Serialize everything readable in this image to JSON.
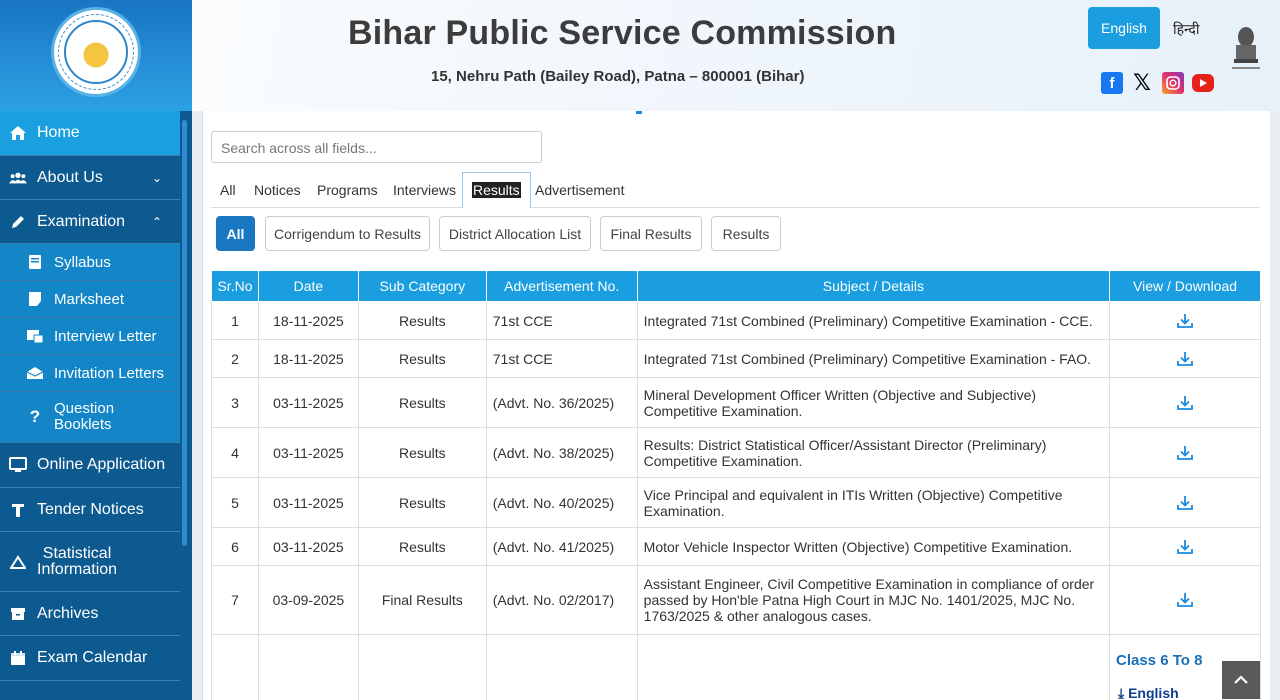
{
  "header": {
    "title": "Bihar Public Service Commission",
    "address": "15, Nehru Path (Bailey Road), Patna – 800001 (Bihar)",
    "lang_english": "English",
    "lang_hindi": "हिन्दी"
  },
  "sidebar": {
    "items": [
      {
        "label": "Home",
        "icon": "home-icon",
        "active": true
      },
      {
        "label": "About Us",
        "icon": "users-icon"
      },
      {
        "label": "Examination",
        "icon": "pencil-icon"
      },
      {
        "label": "Syllabus",
        "icon": "book-icon",
        "sub": true
      },
      {
        "label": "Marksheet",
        "icon": "sheet-icon",
        "sub": true
      },
      {
        "label": "Interview Letter",
        "icon": "letter-icon",
        "sub": true
      },
      {
        "label": "Invitation Letters",
        "icon": "envelope-icon",
        "sub": true
      },
      {
        "label": "Question",
        "label2": "Booklets",
        "icon": "question-icon",
        "sub": true
      },
      {
        "label": "Online Application",
        "icon": "monitor-icon"
      },
      {
        "label": "Tender Notices",
        "icon": "tender-icon"
      },
      {
        "label": "Statistical",
        "label2": "Information",
        "icon": "chart-icon"
      },
      {
        "label": "Archives",
        "icon": "archive-icon"
      },
      {
        "label": "Exam Calendar",
        "icon": "calendar-icon"
      }
    ]
  },
  "search": {
    "placeholder": "Search across all fields..."
  },
  "tabs": [
    "All",
    "Notices",
    "Programs",
    "Interviews",
    "Results",
    "Advertisement"
  ],
  "filters": [
    "All",
    "Corrigendum to Results",
    "District Allocation List",
    "Final Results",
    "Results"
  ],
  "table": {
    "headers": [
      "Sr.No",
      "Date",
      "Sub Category",
      "Advertisement No.",
      "Subject / Details",
      "View / Download"
    ],
    "rows": [
      {
        "sr": "1",
        "date": "18-11-2025",
        "cat": "Results",
        "adv": "71st CCE",
        "subject": "Integrated 71st Combined (Preliminary) Competitive Examination - CCE."
      },
      {
        "sr": "2",
        "date": "18-11-2025",
        "cat": "Results",
        "adv": "71st CCE",
        "subject": "Integrated 71st Combined (Preliminary) Competitive Examination - FAO."
      },
      {
        "sr": "3",
        "date": "03-11-2025",
        "cat": "Results",
        "adv": "(Advt. No. 36/2025)",
        "subject": "Mineral Development Officer Written (Objective and Subjective) Competitive Examination."
      },
      {
        "sr": "4",
        "date": "03-11-2025",
        "cat": "Results",
        "adv": "(Advt. No. 38/2025)",
        "subject": "Results: District Statistical Officer/Assistant Director (Preliminary) Competitive Examination."
      },
      {
        "sr": "5",
        "date": "03-11-2025",
        "cat": "Results",
        "adv": "(Advt. No. 40/2025)",
        "subject": "Vice Principal and equivalent in ITIs Written (Objective) Competitive Examination."
      },
      {
        "sr": "6",
        "date": "03-11-2025",
        "cat": "Results",
        "adv": "(Advt. No. 41/2025)",
        "subject": "Motor Vehicle Inspector Written (Objective) Competitive Examination."
      },
      {
        "sr": "7",
        "date": "03-09-2025",
        "cat": "Final Results",
        "adv": "(Advt. No. 02/2017)",
        "subject": "Assistant Engineer, Civil Competitive Examination in compliance of order passed by Hon'ble Patna High Court in MJC No. 1401/2025, MJC No. 1763/2025 & other analogous cases."
      }
    ]
  },
  "extra": {
    "class_label": "Class 6 To 8",
    "class_link": "English"
  },
  "colors": {
    "accent": "#1a9ee0",
    "sidebar": "#0d5a91",
    "sidebar_active": "#1aa0e0"
  }
}
